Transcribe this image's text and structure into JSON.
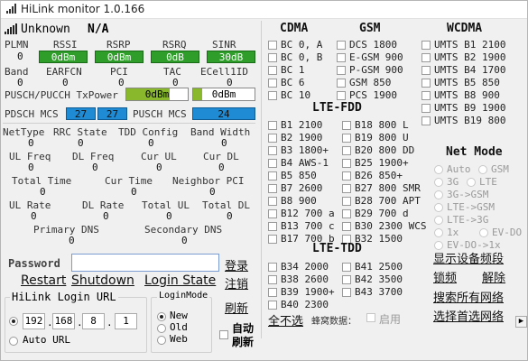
{
  "window": {
    "title": "HiLink monitor 1.0.166"
  },
  "status": {
    "network": "Unknown",
    "type": "N/A"
  },
  "labels": {
    "plmn": "PLMN",
    "rssi": "RSSI",
    "rsrp": "RSRP",
    "rsrq": "RSRQ",
    "sinr": "SINR",
    "band": "Band",
    "earfcn": "EARFCN",
    "pci": "PCI",
    "tac": "TAC",
    "ecellid": "ECell1ID",
    "pusch_power": "PUSCH/PUCCH TxPower",
    "pdsch_mcs": "PDSCH MCS",
    "pusch_mcs": "PUSCH MCS",
    "nettype": "NetType",
    "rrc": "RRC State",
    "tdd": "TDD Config",
    "bandwidth": "Band Width",
    "ul_freq": "UL Freq",
    "dl_freq": "DL Freq",
    "cur_ul": "Cur UL",
    "cur_dl": "Cur DL",
    "total_time": "Total Time",
    "cur_time": "Cur Time",
    "neighbor_pci": "Neighbor PCI",
    "ul_rate": "UL Rate",
    "dl_rate": "DL Rate",
    "total_ul": "Total UL",
    "total_dl": "Total DL",
    "primary_dns": "Primary DNS",
    "secondary_dns": "Secondary DNS"
  },
  "values": {
    "plmn": "0",
    "rssi": "0dBm",
    "rsrp": "0dBm",
    "rsrq": "0dB",
    "sinr": "30dB",
    "band": "0",
    "earfcn": "0",
    "pci": "0",
    "tac": "0",
    "ecellid": "0",
    "pusch_power": "0dBm",
    "pucch_power": "0dBm",
    "pdsch_mcs_1": "27",
    "pdsch_mcs_2": "27",
    "pusch_mcs": "24",
    "pusch_power_level": 0.7,
    "pucch_power_level": 0.15,
    "nettype": "0",
    "rrc": "0",
    "tdd": "0",
    "bandwidth": "0",
    "ul_freq": "0",
    "dl_freq": "0",
    "cur_ul": "0",
    "cur_dl": "0",
    "total_time": "0",
    "cur_time": "0",
    "neighbor_pci": "0",
    "ul_rate": "0",
    "dl_rate": "0",
    "total_ul": "0",
    "total_dl": "0",
    "primary_dns": "0",
    "secondary_dns": "0"
  },
  "login": {
    "password_label": "Password",
    "password_value": "",
    "restart": "Restart",
    "shutdown": "Shutdown",
    "login_state": "Login State",
    "url_label": "HiLink Login URL",
    "ip": [
      "192",
      "168",
      "8",
      "1"
    ],
    "auto_url": "Auto URL",
    "login_mode": "LoginMode",
    "modes": [
      "New",
      "Old",
      "Web"
    ],
    "selected_mode": "New",
    "login_btn": "登录",
    "logout_btn": "注销",
    "refresh_btn": "刷新",
    "auto_refresh": "自动刷新"
  },
  "bands": {
    "cdma_header": "CDMA",
    "gsm_header": "GSM",
    "wcdma_header": "WCDMA",
    "lte_fdd_header": "LTE-FDD",
    "lte_tdd_header": "LTE-TDD",
    "cdma": [
      "BC 0, A",
      "BC 0, B",
      "BC 1",
      "BC 6",
      "BC 10"
    ],
    "gsm": [
      [
        "DCS",
        "1800"
      ],
      [
        "E-GSM",
        "900"
      ],
      [
        "P-GSM",
        "900"
      ],
      [
        "GSM",
        "850"
      ],
      [
        "PCS",
        "1900"
      ]
    ],
    "wcdma": [
      [
        "UMTS B1",
        "2100"
      ],
      [
        "UMTS B2",
        "1900"
      ],
      [
        "UMTS B4",
        "1700"
      ],
      [
        "UMTS B5",
        "850"
      ],
      [
        "UMTS B8",
        "900"
      ],
      [
        "UMTS B9",
        "1900"
      ],
      [
        "UMTS B19",
        "800"
      ]
    ],
    "lte_fdd_left": [
      [
        "B1",
        "2100"
      ],
      [
        "B2",
        "1900"
      ],
      [
        "B3",
        "1800+"
      ],
      [
        "B4",
        "AWS-1"
      ],
      [
        "B5",
        "850"
      ],
      [
        "B7",
        "2600"
      ],
      [
        "B8",
        "900"
      ],
      [
        "B12",
        "700 a"
      ],
      [
        "B13",
        "700 c"
      ],
      [
        "B17",
        "700 b"
      ]
    ],
    "lte_fdd_right": [
      [
        "B18",
        "800 L"
      ],
      [
        "B19",
        "800 U"
      ],
      [
        "B20",
        "800 DD"
      ],
      [
        "B25",
        "1900+"
      ],
      [
        "B26",
        "850+"
      ],
      [
        "B27",
        "800 SMR"
      ],
      [
        "B28",
        "700 APT"
      ],
      [
        "B29",
        "700 d"
      ],
      [
        "B30",
        "2300 WCS"
      ],
      [
        "B32",
        "1500"
      ]
    ],
    "lte_tdd_left": [
      [
        "B34",
        "2000"
      ],
      [
        "B38",
        "2600"
      ],
      [
        "B39",
        "1900+"
      ],
      [
        "B40",
        "2300"
      ]
    ],
    "lte_tdd_right": [
      [
        "B41",
        "2500"
      ],
      [
        "B42",
        "3500"
      ],
      [
        "B43",
        "3700"
      ]
    ],
    "clear_all": "全不选",
    "honeycomb_label": "蜂窝数据：",
    "enable_label": "启用"
  },
  "net_mode": {
    "header": "Net Mode",
    "options": [
      "Auto",
      "GSM",
      "3G",
      "LTE",
      "3G->GSM",
      "LTE->GSM",
      "LTE->3G",
      "1x",
      "EV-DO",
      "EV-DO->1x"
    ]
  },
  "actions": {
    "show_bands": "显示设备频段",
    "lock": "锁频",
    "unlock": "解除",
    "search_all": "搜索所有网络",
    "pick_first": "选择首选网络"
  },
  "colors": {
    "green": "#2e9d2a",
    "blue": "#1f8bd4",
    "lime": "#8ab82c"
  }
}
